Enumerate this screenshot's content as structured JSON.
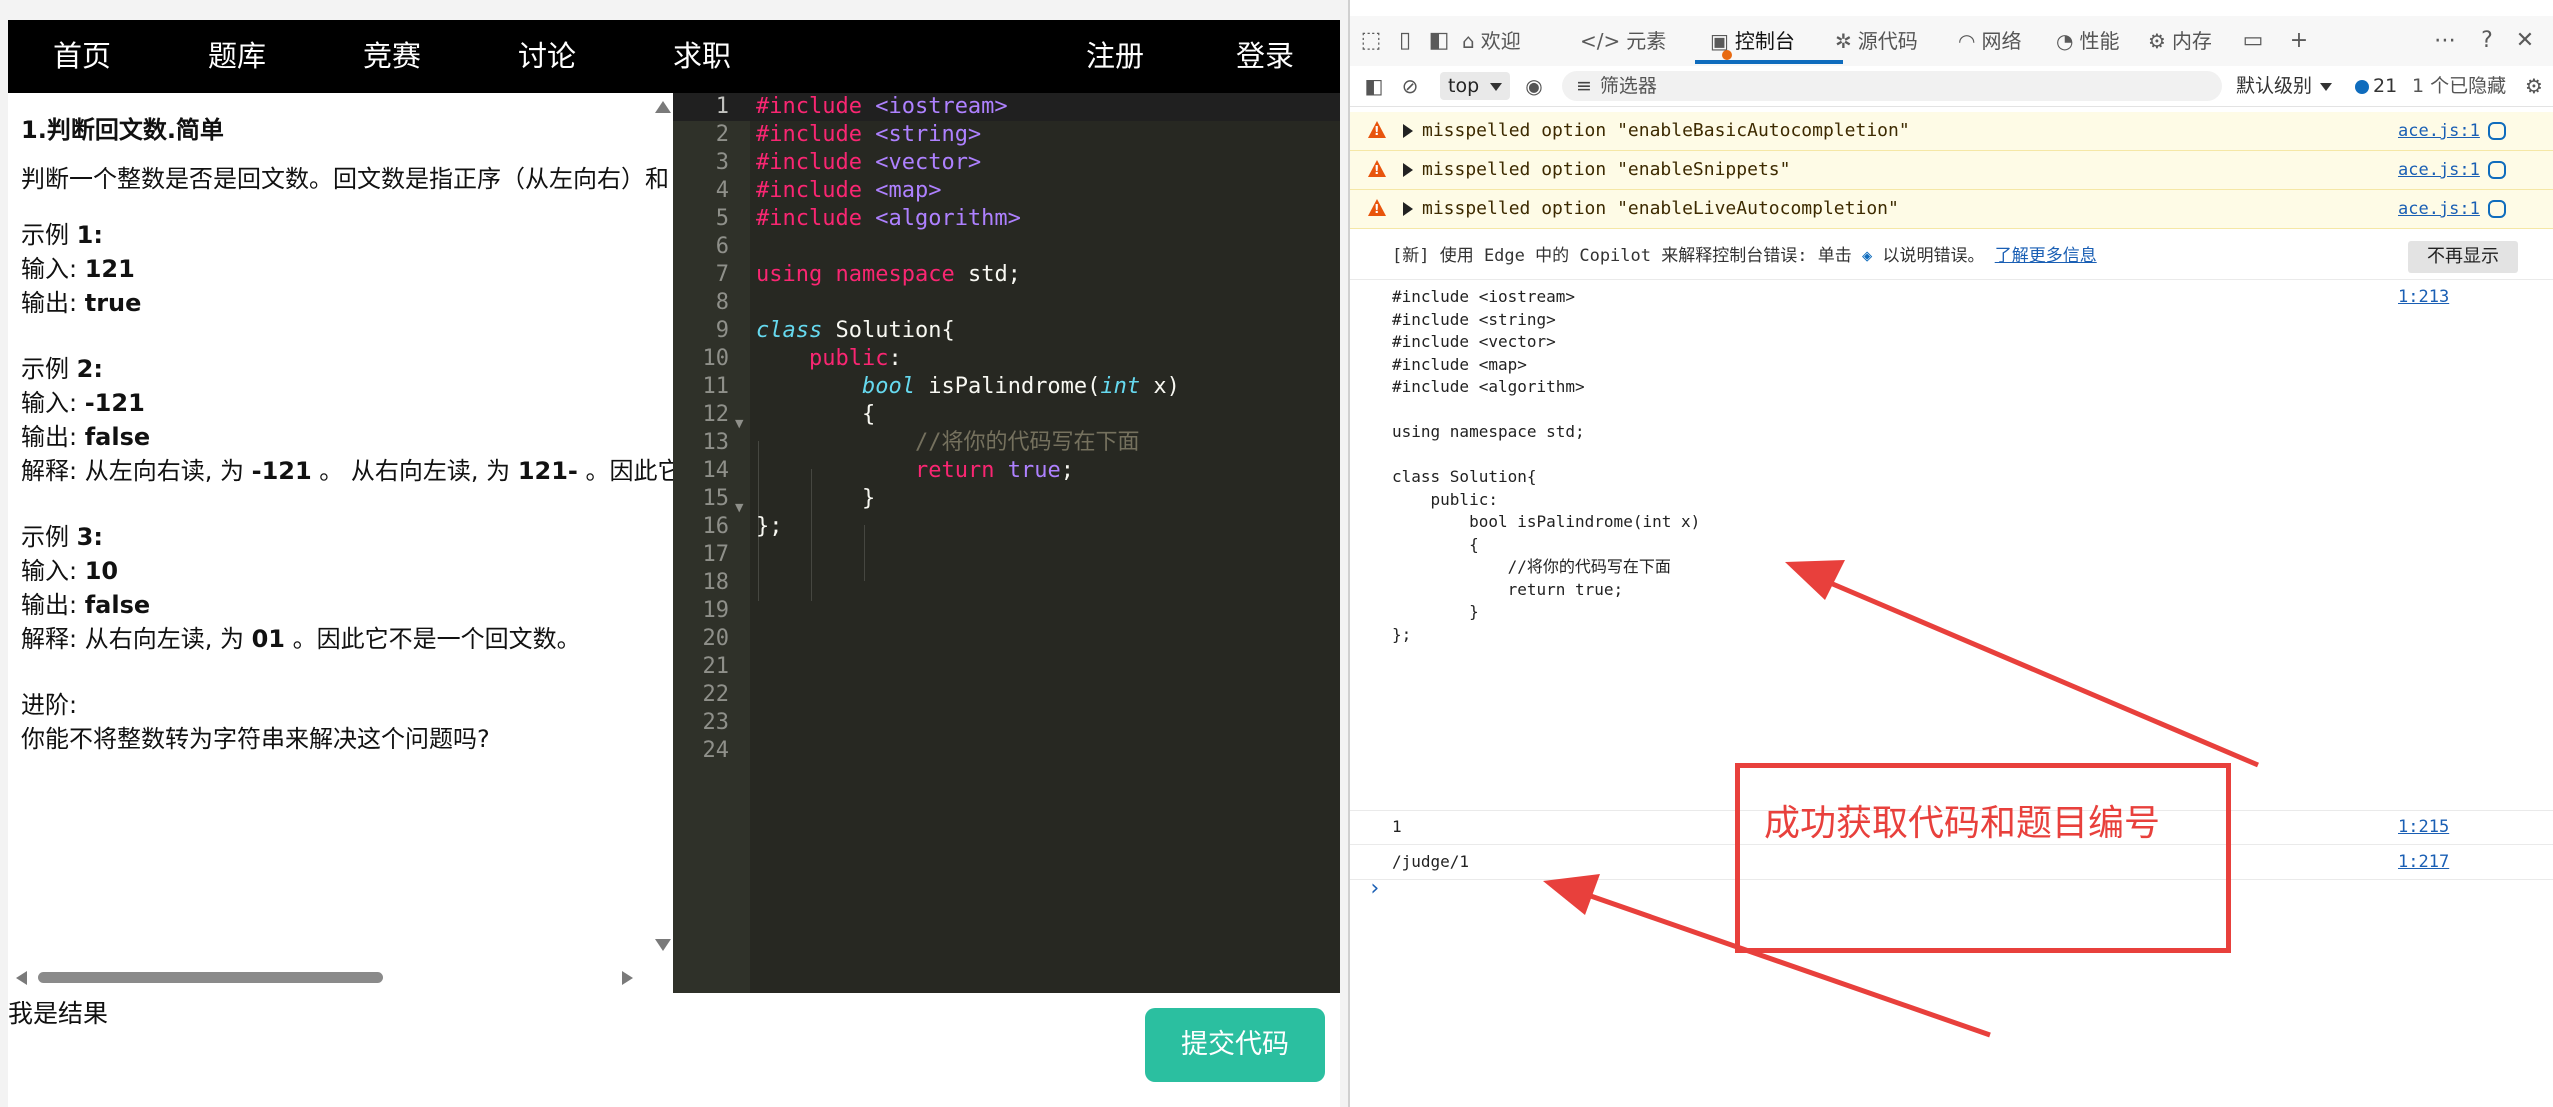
{
  "site": {
    "nav": {
      "home": "首页",
      "problems": "题库",
      "contests": "竞赛",
      "discuss": "讨论",
      "jobs": "求职",
      "register": "注册",
      "login": "登录"
    },
    "problem": {
      "title": "1.判断回文数.简单",
      "description": "判断一个整数是否是回文数。回文数是指正序（从左向右）和",
      "examples": [
        {
          "label_prefix": "示例 ",
          "label_num": "1:",
          "input_label": "输入: ",
          "input": "121",
          "output_label": "输出: ",
          "output": "true"
        },
        {
          "label_prefix": "示例 ",
          "label_num": "2:",
          "input_label": "输入: ",
          "input": "-121",
          "output_label": "输出: ",
          "output": "false",
          "explain_label": "解释: ",
          "explain_a": "从左向右读, 为 ",
          "explain_b": "-121",
          "explain_c": " 。 从右向左读, 为 ",
          "explain_d": "121-",
          "explain_e": " 。因此它不是一个回文数。"
        },
        {
          "label_prefix": "示例 ",
          "label_num": "3:",
          "input_label": "输入: ",
          "input": "10",
          "output_label": "输出: ",
          "output": "false",
          "explain_label": "解释: ",
          "explain_a": "从右向左读, 为 ",
          "explain_b": "01",
          "explain_c": " 。因此它不是一个回文数。"
        }
      ],
      "advanced_label": "进阶:",
      "advanced_text": "你能不将整数转为字符串来解决这个问题吗?"
    },
    "editor": {
      "line_numbers": [
        "1",
        "2",
        "3",
        "4",
        "5",
        "6",
        "7",
        "8",
        "9",
        "10",
        "11",
        "12",
        "13",
        "14",
        "15",
        "16",
        "17",
        "18",
        "19",
        "20",
        "21",
        "22",
        "23",
        "24"
      ],
      "inc_directive": "#include",
      "includes": [
        "<iostream>",
        "<string>",
        "<vector>",
        "<map>",
        "<algorithm>"
      ],
      "using_kw": "using",
      "namespace_kw": "namespace",
      "using_rest": " std;",
      "class_kw": "class",
      "class_rest": " Solution{",
      "public_kw": "public",
      "public_rest": ":",
      "bool_kw": "bool",
      "fn_name": " isPalindrome(",
      "int_kw": "int",
      "fn_param": " x)",
      "brace_open": "{",
      "comment": "//将你的代码写在下面",
      "return_kw": "return",
      "true_kw": "true",
      "semicolon": ";",
      "brace_close": "}",
      "class_close": "};"
    },
    "result_text": "我是结果",
    "submit_label": "提交代码"
  },
  "devtools": {
    "tabs": {
      "welcome": "欢迎",
      "elements": "元素",
      "console": "控制台",
      "sources": "源代码",
      "network": "网络",
      "performance": "性能",
      "memory": "内存"
    },
    "toolbar": {
      "context": "top",
      "filter_placeholder": "筛选器",
      "level": "默认级别",
      "message_count": "21",
      "hidden": "1 个已隐藏"
    },
    "warnings": [
      {
        "text": "misspelled option \"enableBasicAutocompletion\"",
        "source": "ace.js:1"
      },
      {
        "text": "misspelled option \"enableSnippets\"",
        "source": "ace.js:1"
      },
      {
        "text": "misspelled option \"enableLiveAutocompletion\"",
        "source": "ace.js:1"
      }
    ],
    "hint": {
      "text": "[新] 使用 Edge 中的 Copilot 来解释控制台错误: 单击",
      "text2": "以说明错误。",
      "link": "了解更多信息",
      "dismiss": "不再显示"
    },
    "logs": [
      {
        "value": "#include <iostream>\n#include <string>\n#include <vector>\n#include <map>\n#include <algorithm>\n\nusing namespace std;\n\nclass Solution{\n    public:\n        bool isPalindrome(int x)\n        {\n            //将你的代码写在下面\n            return true;\n        }\n};",
        "source": "1:213"
      },
      {
        "value": "1",
        "source": "1:215"
      },
      {
        "value": "/judge/1",
        "source": "1:217"
      }
    ],
    "prompt": "›"
  },
  "annotation": {
    "text": "成功获取代码和题目编号",
    "color": "#e8403c"
  },
  "colors": {
    "navbar": "#000000",
    "editor_bg": "#272822",
    "submit": "#2bbfa0",
    "warning_bg": "#fefbe6",
    "link": "#1a5fb4"
  }
}
